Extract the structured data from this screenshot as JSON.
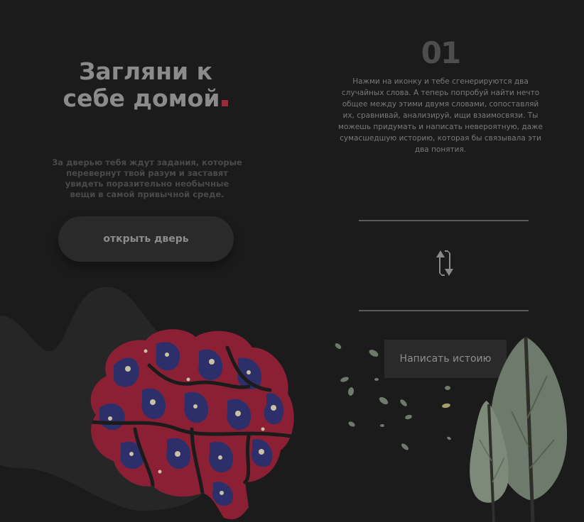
{
  "hero": {
    "title_line1": "Загляни к",
    "title_line2": "себе домой",
    "subtitle": "За дверью тебя ждут задания, которые перевернут твой разум и заставят увидеть поразительно необычные вещи в самой привычной среде.",
    "open_button": "открыть дверь"
  },
  "task": {
    "step_number": "01",
    "instruction": "Нажми на иконку и тебе сгенерируются два случайных слова. А теперь попробуй найти нечто общее между этими двумя словами, сопоставляй их, сравнивай, анализируй, ищи взаимосвязи. Ты можешь придумать и написать невероятную, даже сумасшедшую историю, которая бы связывала эти два понятия.",
    "write_button": "Написать истоию"
  },
  "colors": {
    "background": "#1b1b1c",
    "accent": "#9a2b3c",
    "brain_red": "#8b2035",
    "brain_blue": "#2d2f6b",
    "tree_green": "#6e7a6c"
  },
  "icons": {
    "swap": "swap-arrows-icon"
  }
}
